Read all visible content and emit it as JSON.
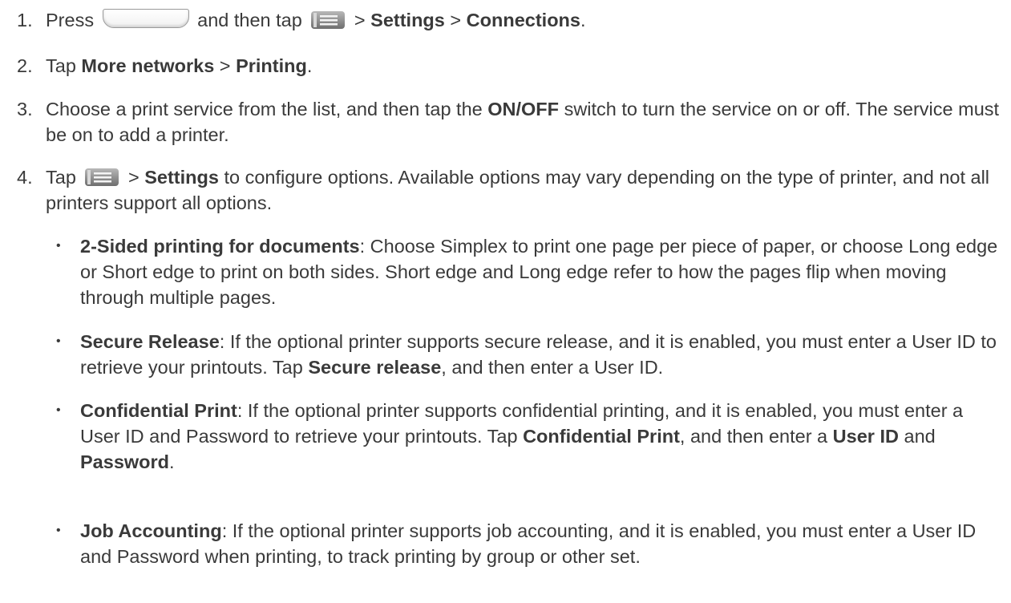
{
  "steps": {
    "s1": {
      "num": "1.",
      "press": "Press",
      "then_tap": "and then tap",
      "sep1": ">",
      "settings": "Settings",
      "sep2": ">",
      "connections": "Connections",
      "end": "."
    },
    "s2": {
      "num": "2.",
      "tap": "Tap",
      "more_networks": "More networks",
      "sep": ">",
      "printing": "Printing",
      "end": "."
    },
    "s3": {
      "num": "3.",
      "t1": "Choose a print service from the list, and then tap the",
      "onoff": "ON/OFF",
      "t2": "switch to turn the service on or off. The service must be on to add a printer."
    },
    "s4": {
      "num": "4.",
      "tap": "Tap",
      "sep": ">",
      "settings": "Settings",
      "t2": "to configure options. Available options may vary depending on the type of printer, and not all printers support all options."
    }
  },
  "bullets": {
    "b1": {
      "term": "2-Sided printing for documents",
      "text": ": Choose Simplex to print one page per piece of paper, or choose Long edge or Short edge to print on both sides. Short edge and Long edge refer to how the pages flip when moving through multiple pages."
    },
    "b2": {
      "term": "Secure Release",
      "t1": ": If the optional printer supports secure release, and it is enabled, you must enter a User ID to retrieve your printouts. Tap",
      "link": "Secure release",
      "t2": ", and then enter a User ID."
    },
    "b3": {
      "term": "Confidential Print",
      "t1": ": If the optional printer supports confidential printing, and it is enabled, you must enter a User ID and Password to retrieve your printouts. Tap",
      "link": "Confidential Print",
      "t2": ", and then enter a",
      "userid": "User ID",
      "and": "and",
      "password": "Password",
      "end": "."
    },
    "b4": {
      "term": "Job Accounting",
      "text": ": If the optional printer supports job accounting, and it is enabled, you must enter a User ID and Password when printing, to track printing by group or other set."
    },
    "dot": "•"
  },
  "icons": {
    "home": "home-key-icon",
    "menu": "menu-key-icon"
  }
}
